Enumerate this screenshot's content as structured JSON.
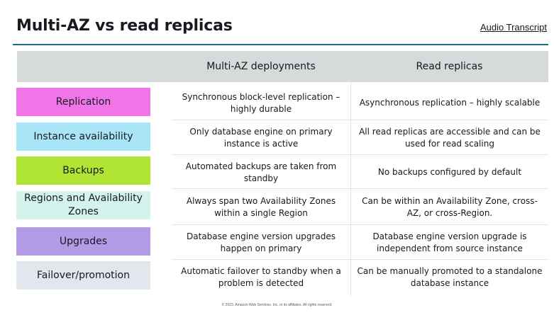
{
  "title": "Multi-AZ vs read replicas",
  "audio_link": "Audio Transcript",
  "columns": [
    "Multi-AZ deployments",
    "Read replicas"
  ],
  "rows": [
    {
      "label": "Replication",
      "color": "#f075e7",
      "multi_az": "Synchronous block-level replication – highly durable",
      "read_replicas": "Asynchronous replication – highly scalable"
    },
    {
      "label": "Instance availability",
      "color": "#a8e6f7",
      "multi_az": "Only database engine on primary instance is active",
      "read_replicas": "All read replicas are accessible and can be used for read scaling"
    },
    {
      "label": "Backups",
      "color": "#b0e534",
      "multi_az": "Automated backups are taken from standby",
      "read_replicas": "No backups configured by default"
    },
    {
      "label": "Regions and Availability Zones",
      "color": "#d5f3ed",
      "multi_az": "Always span two Availability Zones within a single Region",
      "read_replicas": "Can be within an Availability Zone, cross-AZ, or cross-Region."
    },
    {
      "label": "Upgrades",
      "color": "#b39be8",
      "multi_az": "Database engine version upgrades happen on primary",
      "read_replicas": "Database engine version upgrade is independent from source instance"
    },
    {
      "label": "Failover/promotion",
      "color": "#e2e7ee",
      "multi_az": "Automatic failover to standby when a problem is detected",
      "read_replicas": "Can be manually promoted to a standalone database instance"
    }
  ],
  "copyright": "© 2023, Amazon Web Services, Inc. or its affiliates. All rights reserved."
}
